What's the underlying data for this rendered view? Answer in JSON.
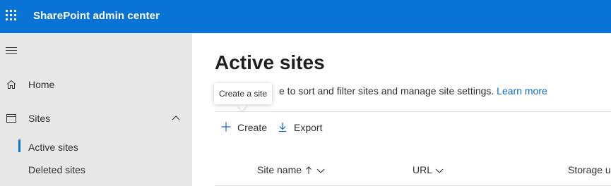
{
  "header": {
    "app_title": "SharePoint admin center",
    "waffle_icon": "app-launcher-icon",
    "accent_color": "#0a74d6"
  },
  "sidebar": {
    "menu_icon": "hamburger-icon",
    "items": [
      {
        "label": "Home",
        "icon": "home-icon"
      },
      {
        "label": "Sites",
        "icon": "browser-window-icon",
        "expanded": true
      }
    ],
    "sub_items": [
      {
        "label": "Active sites",
        "active": true
      },
      {
        "label": "Deleted sites",
        "active": false
      }
    ]
  },
  "main": {
    "title": "Active sites",
    "description_visible": "e to sort and filter sites and manage site settings.",
    "learn_more": "Learn more",
    "tooltip": "Create a site",
    "commands": [
      {
        "label": "Create",
        "icon": "plus-icon"
      },
      {
        "label": "Export",
        "icon": "download-icon"
      }
    ],
    "columns": [
      {
        "label": "Site name",
        "sort": "ascending"
      },
      {
        "label": "URL"
      },
      {
        "label": "Storage u"
      }
    ]
  }
}
